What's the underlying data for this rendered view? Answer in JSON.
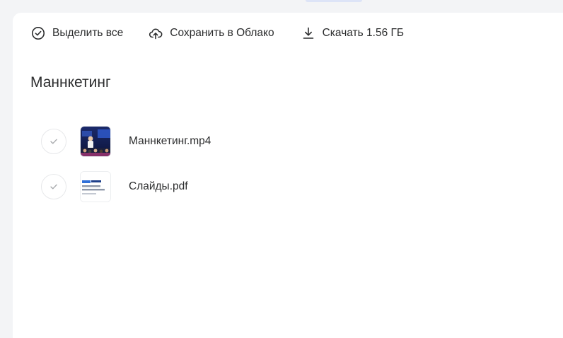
{
  "toolbar": {
    "select_all_label": "Выделить все",
    "save_to_cloud_label": "Сохранить в Облако",
    "download_label": "Скачать 1.56 ГБ"
  },
  "folder": {
    "title": "Маннкетинг"
  },
  "files": [
    {
      "name": "Маннкетинг.mp4",
      "thumbnail": "video-frame-icon"
    },
    {
      "name": "Слайды.pdf",
      "thumbnail": "pdf-slide-icon"
    }
  ],
  "colors": {
    "background": "#f3f4f6",
    "panel": "#ffffff",
    "text": "#2c2d2e",
    "checkbox_border": "#e7e8ea"
  }
}
